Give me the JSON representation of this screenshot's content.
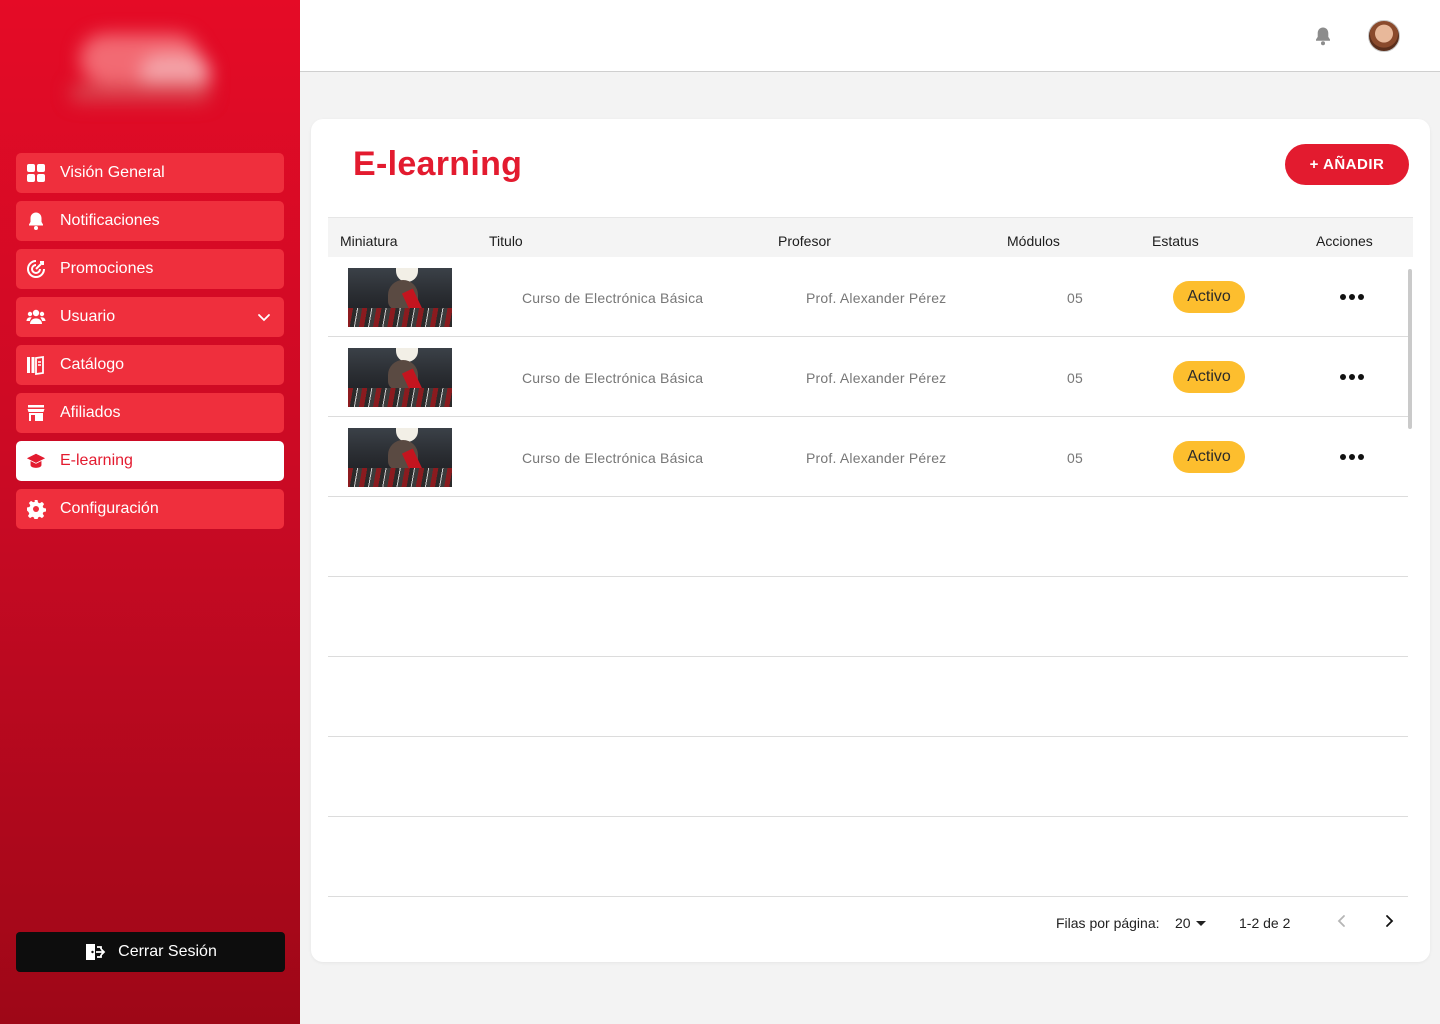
{
  "colors": {
    "brand_red": "#e31b2f",
    "status_active": "#fdbe2e",
    "sidebar_item": "#ef2f3d"
  },
  "sidebar": {
    "items": [
      {
        "label": "Visión General",
        "icon": "grid-icon",
        "active": false
      },
      {
        "label": "Notificaciones",
        "icon": "bell-icon",
        "active": false
      },
      {
        "label": "Promociones",
        "icon": "target-icon",
        "active": false
      },
      {
        "label": "Usuario",
        "icon": "users-icon",
        "active": false,
        "expandable": true
      },
      {
        "label": "Catálogo",
        "icon": "catalog-icon",
        "active": false
      },
      {
        "label": "Afiliados",
        "icon": "store-icon",
        "active": false
      },
      {
        "label": "E-learning",
        "icon": "graduation-cap-icon",
        "active": true
      },
      {
        "label": "Configuración",
        "icon": "gear-icon",
        "active": false
      }
    ],
    "logout_label": "Cerrar Sesión"
  },
  "page": {
    "title": "E-learning",
    "add_label": "+ AÑADIR"
  },
  "table": {
    "headers": {
      "thumbnail": "Miniatura",
      "title": "Titulo",
      "teacher": "Profesor",
      "modules": "Módulos",
      "status": "Estatus",
      "actions": "Acciones"
    },
    "rows": [
      {
        "title": "Curso de Electrónica Básica",
        "teacher": "Prof. Alexander Pérez",
        "modules": "05",
        "status": "Activo"
      },
      {
        "title": "Curso de Electrónica Básica",
        "teacher": "Prof. Alexander Pérez",
        "modules": "05",
        "status": "Activo"
      },
      {
        "title": "Curso de Electrónica Básica",
        "teacher": "Prof. Alexander Pérez",
        "modules": "05",
        "status": "Activo"
      }
    ]
  },
  "pagination": {
    "rows_per_page_label": "Filas por página:",
    "rows_per_page": "20",
    "range": "1-2 de 2"
  }
}
